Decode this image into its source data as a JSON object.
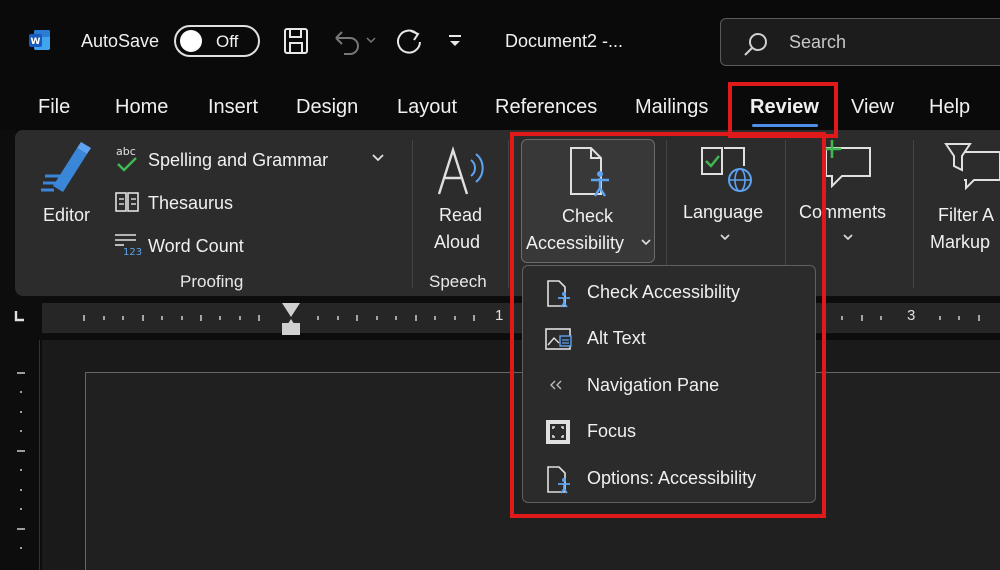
{
  "titlebar": {
    "autosave_label": "AutoSave",
    "autosave_state": "Off",
    "doc_title": "Document2  -...",
    "search_placeholder": "Search"
  },
  "tabs": [
    "File",
    "Home",
    "Insert",
    "Design",
    "Layout",
    "References",
    "Mailings",
    "Review",
    "View",
    "Help"
  ],
  "active_tab": "Review",
  "ribbon": {
    "editor": "Editor",
    "spelling": "Spelling and Grammar",
    "thesaurus": "Thesaurus",
    "word_count": "Word Count",
    "proofing_label": "Proofing",
    "read_aloud_1": "Read",
    "read_aloud_2": "Aloud",
    "speech_label": "Speech",
    "check_acc_1": "Check",
    "check_acc_2": "Accessibility",
    "language": "Language",
    "comments": "Comments",
    "filter_1": "Filter A",
    "filter_2": "Markup"
  },
  "ruler": {
    "num1": "1",
    "num3": "3"
  },
  "dropdown": {
    "items": [
      {
        "label": "Check Accessibility",
        "icon": "check-accessibility-icon"
      },
      {
        "label": "Alt Text",
        "icon": "alt-text-icon"
      },
      {
        "label": "Navigation Pane",
        "icon": "navigation-pane-icon"
      },
      {
        "label": "Focus",
        "icon": "focus-icon"
      },
      {
        "label": "Options: Accessibility",
        "icon": "options-accessibility-icon"
      }
    ]
  },
  "colors": {
    "accent": "#4f8fe8",
    "highlight": "#e0191b",
    "ribbon_bg": "#2c2c2c"
  }
}
